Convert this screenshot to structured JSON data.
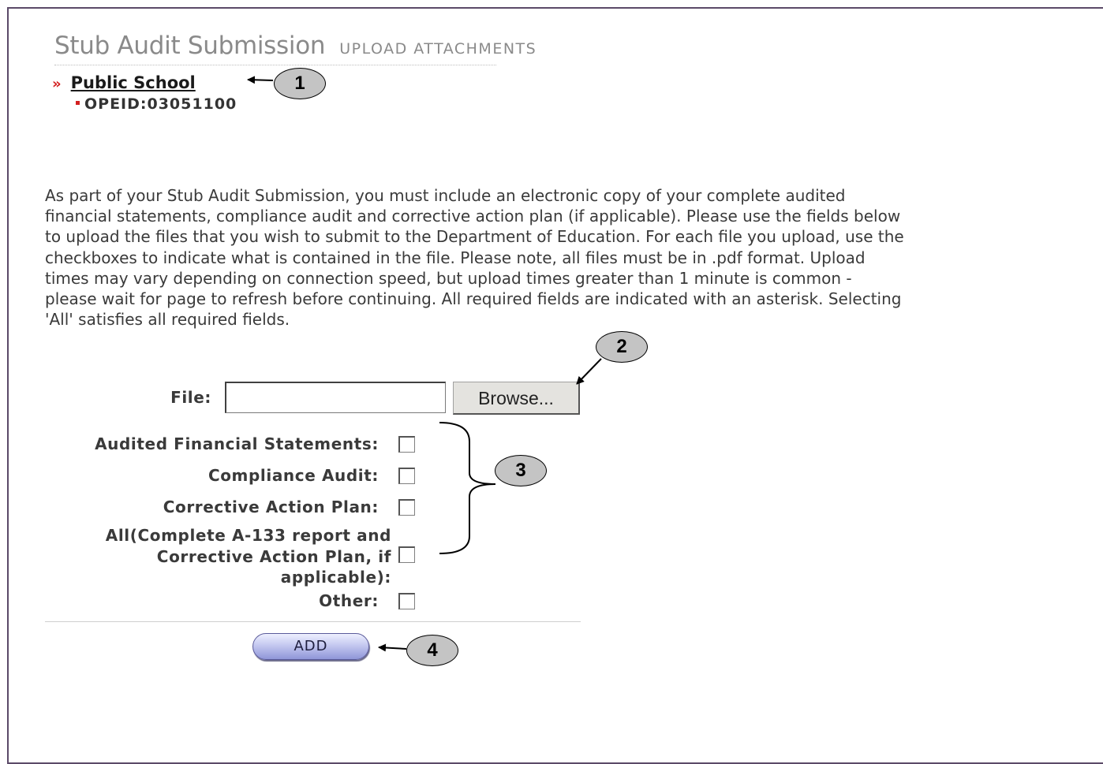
{
  "header": {
    "title": "Stub Audit Submission",
    "subtitle": "UPLOAD ATTACHMENTS"
  },
  "school": {
    "chevron": "»",
    "name": "Public School",
    "opeid": "OPEID:03051100"
  },
  "instructions": "As part of your Stub Audit Submission, you must include an electronic copy of your complete audited financial statements, compliance audit and corrective action plan (if applicable). Please use the fields below to upload the files that you wish to submit to the Department of Education. For each file you upload, use the checkboxes to indicate what is contained in the file. Please note, all files must be in .pdf format. Upload times may vary depending on connection speed, but upload times greater than 1 minute is common - please wait for page to refresh before continuing. All required fields are indicated with an asterisk. Selecting 'All' satisfies all required fields.",
  "form": {
    "file_label": "File:",
    "file_value": "",
    "browse_label": "Browse...",
    "checkboxes": [
      {
        "label": "Audited Financial Statements:",
        "checked": false
      },
      {
        "label": "Compliance Audit:",
        "checked": false
      },
      {
        "label": "Corrective Action Plan:",
        "checked": false
      },
      {
        "label": "All(Complete A-133 report and Corrective Action Plan, if applicable):",
        "checked": false
      },
      {
        "label": "Other:",
        "checked": false
      }
    ],
    "add_label": "ADD"
  },
  "callouts": [
    "1",
    "2",
    "3",
    "4"
  ]
}
